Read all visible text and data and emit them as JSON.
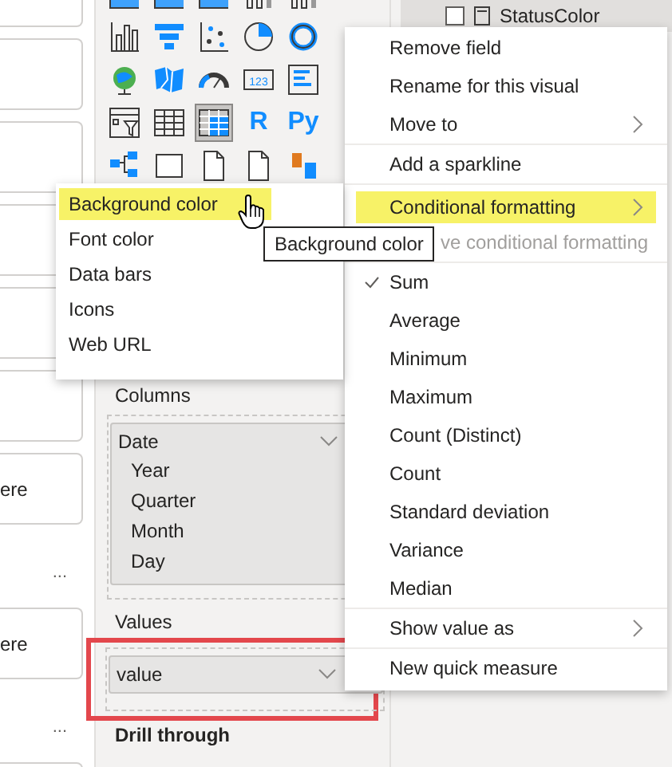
{
  "left_cards": [
    {
      "kind": "card"
    },
    {
      "kind": "card"
    },
    {
      "kind": "card"
    },
    {
      "kind": "card"
    },
    {
      "kind": "card"
    },
    {
      "kind": "card"
    },
    {
      "kind": "card",
      "text": "ere"
    },
    {
      "kind": "more",
      "text": "..."
    },
    {
      "kind": "card",
      "text": "ere"
    },
    {
      "kind": "more",
      "text": "..."
    },
    {
      "kind": "card"
    }
  ],
  "visuals": [
    {
      "kind": "area",
      "selected": false
    },
    {
      "kind": "area",
      "selected": false
    },
    {
      "kind": "area",
      "selected": false
    },
    {
      "kind": "combo",
      "selected": false
    },
    {
      "kind": "combo",
      "selected": false
    },
    {
      "kind": "bar",
      "selected": false
    },
    {
      "kind": "funnel",
      "selected": false
    },
    {
      "kind": "scatter",
      "selected": false
    },
    {
      "kind": "pie",
      "selected": false
    },
    {
      "kind": "donut",
      "selected": false
    },
    {
      "kind": "globe",
      "selected": false
    },
    {
      "kind": "map",
      "selected": false
    },
    {
      "kind": "gauge",
      "selected": false
    },
    {
      "kind": "card",
      "label": "123",
      "selected": false
    },
    {
      "kind": "multirow",
      "selected": false
    },
    {
      "kind": "slicer",
      "selected": false
    },
    {
      "kind": "table",
      "selected": false
    },
    {
      "kind": "matrix",
      "selected": true
    },
    {
      "kind": "letters",
      "label": "R",
      "selected": false
    },
    {
      "kind": "letters",
      "label": "Py",
      "selected": false
    },
    {
      "kind": "tree",
      "selected": false
    },
    {
      "kind": "shape",
      "selected": false
    },
    {
      "kind": "doc",
      "selected": false
    },
    {
      "kind": "doc",
      "selected": false
    },
    {
      "kind": "influencer",
      "selected": false
    }
  ],
  "columns": {
    "title": "Columns",
    "field": {
      "label": "Date",
      "children": [
        "Year",
        "Quarter",
        "Month",
        "Day"
      ]
    }
  },
  "values": {
    "title": "Values",
    "field": {
      "label": "value"
    },
    "highlighted": true
  },
  "drill_through": {
    "title": "Drill through"
  },
  "fields_list": {
    "item": "StatusColor",
    "checked": false
  },
  "context_menu": {
    "groups": [
      [
        {
          "label": "Remove field",
          "selected": false,
          "disabled": false,
          "submenu": false
        },
        {
          "label": "Rename for this visual",
          "selected": false,
          "disabled": false,
          "submenu": false
        },
        {
          "label": "Move to",
          "selected": false,
          "disabled": false,
          "submenu": true
        }
      ],
      [
        {
          "label": "Add a sparkline",
          "selected": false,
          "disabled": false,
          "submenu": false
        }
      ],
      [
        {
          "label": "Conditional formatting",
          "selected": true,
          "disabled": false,
          "submenu": true
        },
        {
          "label": "ve conditional formatting",
          "selected": false,
          "disabled": true,
          "submenu": false
        }
      ],
      [
        {
          "label": "Sum",
          "checked": true,
          "selected": false,
          "disabled": false,
          "submenu": false
        },
        {
          "label": "Average",
          "checked": false,
          "selected": false,
          "disabled": false,
          "submenu": false
        },
        {
          "label": "Minimum",
          "checked": false,
          "selected": false,
          "disabled": false,
          "submenu": false
        },
        {
          "label": "Maximum",
          "checked": false,
          "selected": false,
          "disabled": false,
          "submenu": false
        },
        {
          "label": "Count (Distinct)",
          "checked": false,
          "selected": false,
          "disabled": false,
          "submenu": false
        },
        {
          "label": "Count",
          "checked": false,
          "selected": false,
          "disabled": false,
          "submenu": false
        },
        {
          "label": "Standard deviation",
          "checked": false,
          "selected": false,
          "disabled": false,
          "submenu": false
        },
        {
          "label": "Variance",
          "checked": false,
          "selected": false,
          "disabled": false,
          "submenu": false
        },
        {
          "label": "Median",
          "checked": false,
          "selected": false,
          "disabled": false,
          "submenu": false
        }
      ],
      [
        {
          "label": "Show value as",
          "selected": false,
          "disabled": false,
          "submenu": true
        }
      ],
      [
        {
          "label": "New quick measure",
          "selected": false,
          "disabled": false,
          "submenu": false
        }
      ]
    ]
  },
  "submenu": {
    "items": [
      {
        "label": "Background color",
        "selected": true
      },
      {
        "label": "Font color",
        "selected": false
      },
      {
        "label": "Data bars",
        "selected": false
      },
      {
        "label": "Icons",
        "selected": false
      },
      {
        "label": "Web URL",
        "selected": false
      }
    ]
  },
  "tooltip": {
    "text": "Background color"
  }
}
